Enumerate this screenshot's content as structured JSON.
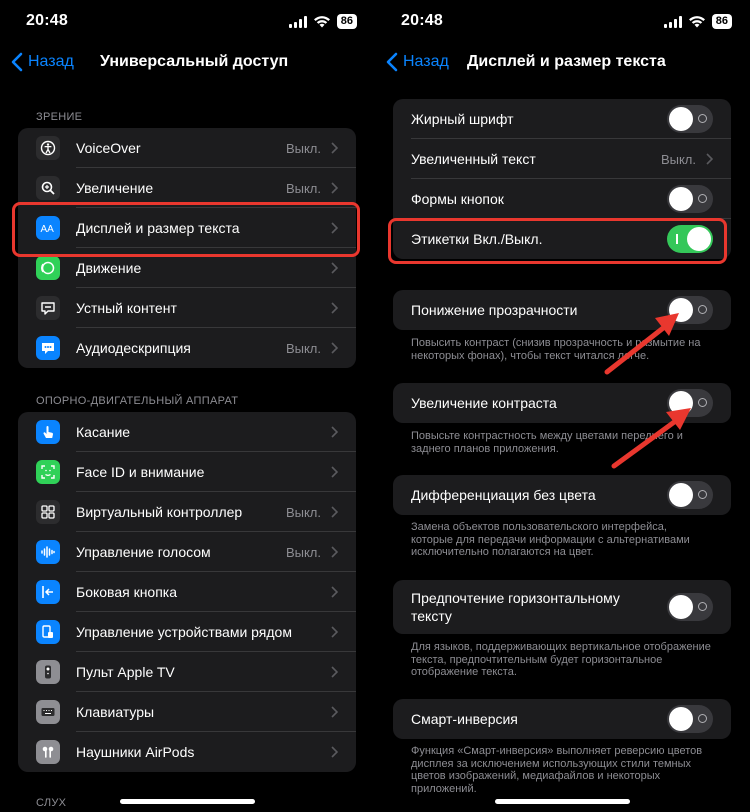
{
  "status": {
    "time": "20:48",
    "battery": "86"
  },
  "left": {
    "back_label": "Назад",
    "title": "Универсальный доступ",
    "section_vision": "ЗРЕНИЕ",
    "vision_items": [
      {
        "label": "VoiceOver",
        "value": "Выкл.",
        "icon": "voiceover-icon",
        "color": "#2c2c2e"
      },
      {
        "label": "Увеличение",
        "value": "Выкл.",
        "icon": "zoom-icon",
        "color": "#2c2c2e"
      },
      {
        "label": "Дисплей и размер текста",
        "value": "",
        "icon": "text-size-icon",
        "color": "#0a84ff"
      },
      {
        "label": "Движение",
        "value": "",
        "icon": "motion-icon",
        "color": "#30d158"
      },
      {
        "label": "Устный контент",
        "value": "",
        "icon": "spoken-content-icon",
        "color": "#2c2c2e"
      },
      {
        "label": "Аудиодескрипция",
        "value": "Выкл.",
        "icon": "audio-description-icon",
        "color": "#0a84ff"
      }
    ],
    "section_motor": "ОПОРНО-ДВИГАТЕЛЬНЫЙ АППАРАТ",
    "motor_items": [
      {
        "label": "Касание",
        "value": "",
        "icon": "touch-icon",
        "color": "#0a84ff"
      },
      {
        "label": "Face ID и внимание",
        "value": "",
        "icon": "face-id-icon",
        "color": "#30d158"
      },
      {
        "label": "Виртуальный контроллер",
        "value": "Выкл.",
        "icon": "switch-control-icon",
        "color": "#2c2c2e"
      },
      {
        "label": "Управление голосом",
        "value": "Выкл.",
        "icon": "voice-control-icon",
        "color": "#0a84ff"
      },
      {
        "label": "Боковая кнопка",
        "value": "",
        "icon": "side-button-icon",
        "color": "#0a84ff"
      },
      {
        "label": "Управление устройствами рядом",
        "value": "",
        "icon": "nearby-devices-icon",
        "color": "#0a84ff"
      },
      {
        "label": "Пульт Apple TV",
        "value": "",
        "icon": "apple-tv-remote-icon",
        "color": "#8e8e93"
      },
      {
        "label": "Клавиатуры",
        "value": "",
        "icon": "keyboard-icon",
        "color": "#8e8e93"
      },
      {
        "label": "Наушники AirPods",
        "value": "",
        "icon": "airpods-icon",
        "color": "#8e8e93"
      }
    ],
    "section_hearing": "СЛУХ"
  },
  "right": {
    "back_label": "Назад",
    "title": "Дисплей и размер текста",
    "group1": [
      {
        "label": "Жирный шрифт",
        "type": "toggle",
        "on": false
      },
      {
        "label": "Увеличенный текст",
        "type": "link",
        "value": "Выкл."
      },
      {
        "label": "Формы кнопок",
        "type": "toggle",
        "on": false
      },
      {
        "label": "Этикетки Вкл./Выкл.",
        "type": "toggle",
        "on": true
      }
    ],
    "reduce_transparency": {
      "label": "Понижение прозрачности",
      "on": false,
      "note": "Повысить контраст (снизив прозрачность и размытие на некоторых фонах), чтобы текст читался легче."
    },
    "increase_contrast": {
      "label": "Увеличение контраста",
      "on": false,
      "note": "Повысьте контрастность между цветами переднего и заднего планов приложения."
    },
    "differentiate": {
      "label": "Дифференциация без цвета",
      "on": false,
      "note": "Замена объектов пользовательского интерфейса, которые для передачи информации с альтернативами исключительно полагаются на цвет."
    },
    "prefer_horizontal": {
      "label": "Предпочтение горизонтальному тексту",
      "on": false,
      "note": "Для языков, поддерживающих вертикальное отображение текста, предпочтительным будет горизонтальное отображение текста."
    },
    "smart_invert": {
      "label": "Смарт-инверсия",
      "on": false,
      "note": "Функция «Смарт-инверсия» выполняет реверсию цветов дисплея за исключением использующих стили темных цветов изображений, медиафайлов и некоторых приложений."
    }
  },
  "colors": {
    "accent": "#0a84ff",
    "highlight": "#e9372e",
    "toggle_on": "#34c759"
  }
}
